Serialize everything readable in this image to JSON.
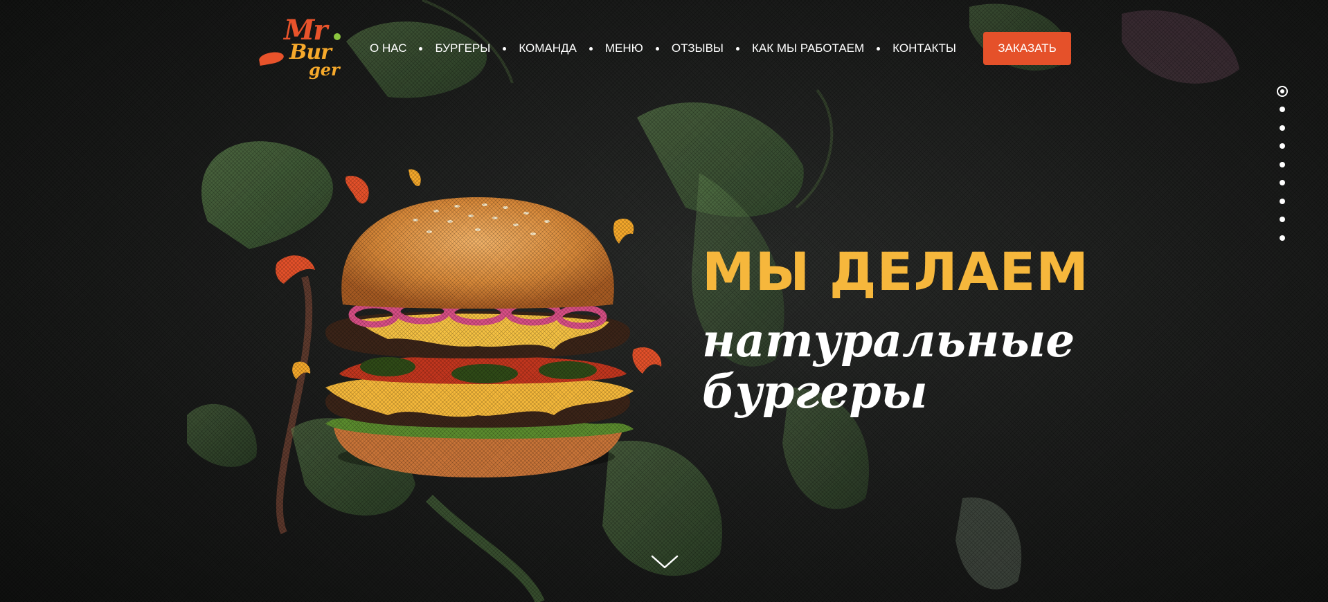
{
  "logo": {
    "line1": "Mr",
    "line2": "Bur",
    "line3": "ger"
  },
  "nav": {
    "items": [
      {
        "label": "О НАС"
      },
      {
        "label": "БУРГЕРЫ"
      },
      {
        "label": "КОМАНДА"
      },
      {
        "label": "МЕНЮ"
      },
      {
        "label": "ОТЗЫВЫ"
      },
      {
        "label": "КАК МЫ РАБОТАЕМ"
      },
      {
        "label": "КОНТАКТЫ"
      }
    ],
    "order_label": "ЗАКАЗАТЬ"
  },
  "hero": {
    "title": "МЫ ДЕЛАЕМ",
    "subtitle_line1": "натуральные",
    "subtitle_line2": "бургеры"
  },
  "pagination": {
    "count": 9,
    "active_index": 0
  },
  "icons": {
    "scroll": "chevron-down-icon",
    "pager_dot": "pager-dot-icon"
  },
  "colors": {
    "accent": "#e5512a",
    "title": "#f6b73c",
    "background": "#1a1b1a"
  }
}
